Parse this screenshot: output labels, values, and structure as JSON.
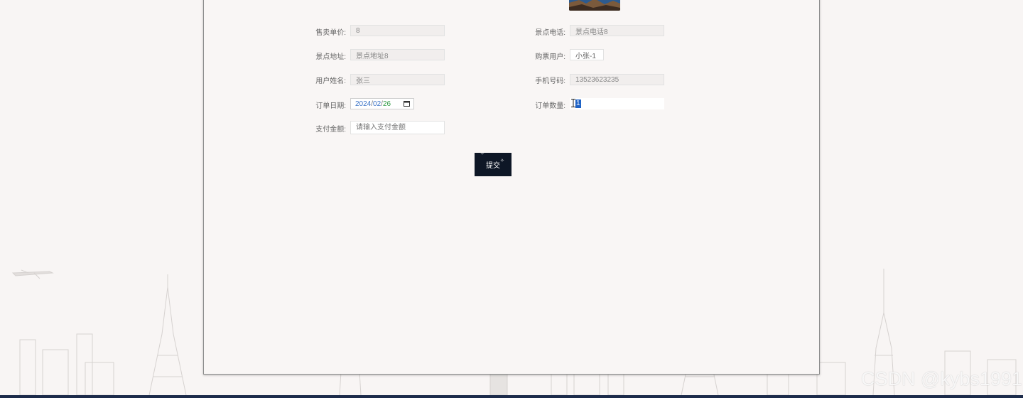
{
  "form": {
    "fields": {
      "price": {
        "label": "售卖单价:",
        "value": "8"
      },
      "scenic_phone": {
        "label": "景点电话:",
        "value": "景点电话8"
      },
      "scenic_address": {
        "label": "景点地址:",
        "value": "景点地址8"
      },
      "buyer_user": {
        "label": "购票用户:",
        "value": "小张-1"
      },
      "user_name": {
        "label": "用户姓名:",
        "value": "张三"
      },
      "mobile": {
        "label": "手机号码:",
        "value": "13523623235"
      },
      "order_date": {
        "label": "订单日期:",
        "year": "2024",
        "sep1": "/",
        "month": "02",
        "sep2": "/",
        "day": "26"
      },
      "order_qty": {
        "label": "订单数量:",
        "value": "1"
      },
      "pay_amount": {
        "label": "支付金额:",
        "placeholder": "请输入支付金额"
      }
    },
    "submit_label": "提交"
  },
  "icons": {
    "calendar": "calendar-icon",
    "cursor": "text-cursor-icon",
    "sparkle": "sparkle-icon",
    "image": "scenic-image"
  },
  "colors": {
    "background": "#f8f5f4",
    "button": "#0e1726",
    "selection": "#1f63c6",
    "bottom_bar": "#1c2b4a"
  },
  "watermark": "CSDN @kybs1991"
}
